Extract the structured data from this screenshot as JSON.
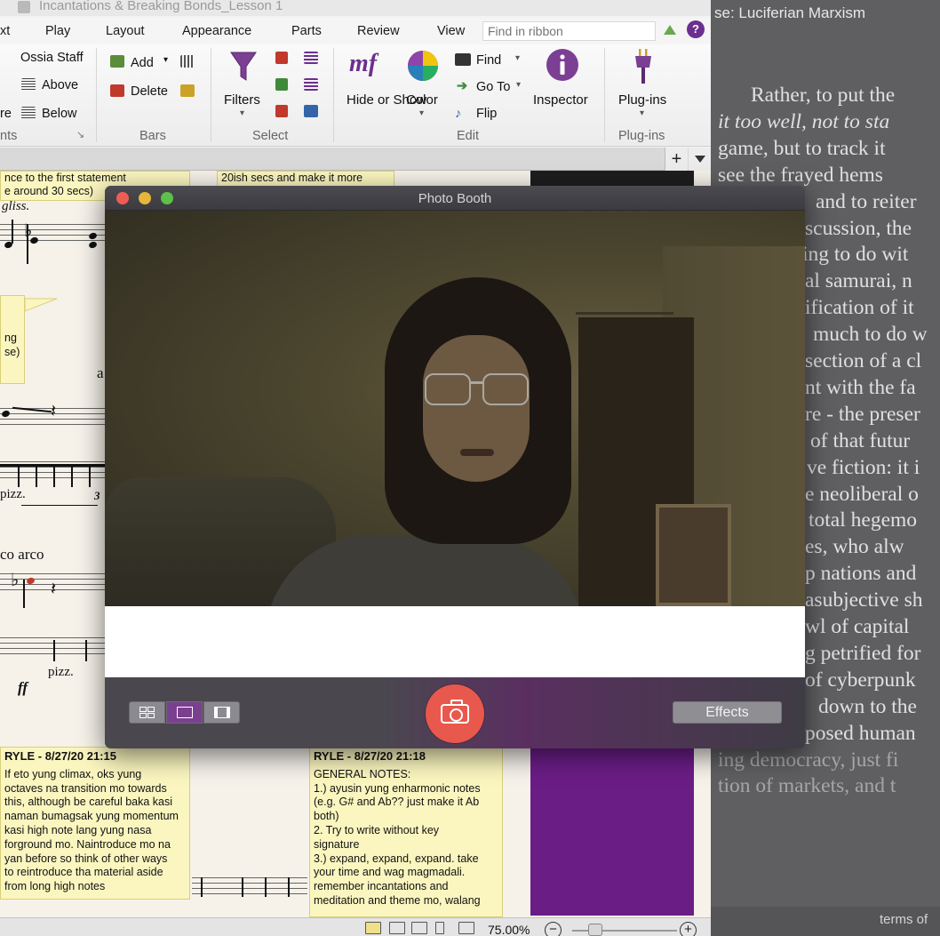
{
  "sibelius": {
    "window_title": "Incantations & Breaking Bonds_Lesson 1",
    "tabs": [
      "xt",
      "Play",
      "Layout",
      "Appearance",
      "Parts",
      "Review",
      "View"
    ],
    "find_placeholder": "Find in ribbon",
    "help_label": "?",
    "ribbon": {
      "staves": {
        "ossia_staff": "Ossia Staff",
        "above": "Above",
        "below": "Below",
        "re_fragment": "re",
        "group_label": "nts"
      },
      "bars": {
        "add": "Add",
        "delete": "Delete",
        "group_label": "Bars"
      },
      "select": {
        "filters": "Filters",
        "group_label": "Select"
      },
      "edit": {
        "hide_or_show": "Hide or Show",
        "color": "Color",
        "find": "Find",
        "go_to": "Go To",
        "flip": "Flip",
        "inspector": "Inspector",
        "group_label": "Edit"
      },
      "plugins": {
        "plugins_button": "Plug-ins",
        "group_label": "Plug-ins"
      }
    },
    "plus_label": "+",
    "score_texts": {
      "top_comment_line1": "nce to the first statement",
      "top_comment_line2": "e around 30 secs)",
      "top_comment_right": "20ish secs and make it more",
      "gliss": "gliss.",
      "left_comment_fragment1": "ng",
      "left_comment_fragment2": "se)",
      "a_fragment": "a",
      "pizz1": "pizz.",
      "triplet": "3",
      "arco": "co arco",
      "pizz2": "pizz.",
      "ff": "ff"
    },
    "comments": [
      {
        "header": "RYLE - 8/27/20 21:15",
        "body": "If eto yung climax, oks yung\noctaves na transition mo towards\nthis, although be careful baka kasi\nnaman bumagsak yung momentum\nkasi high note lang yung nasa\nforground mo. Naintroduce mo na\nyan before so think of other ways\nto reintroduce tha material aside\nfrom long high notes"
      },
      {
        "header": "RYLE - 8/27/20 21:18",
        "body": "GENERAL NOTES:\n1.) ayusin yung enharmonic notes\n(e.g. G# and Ab?? just make it  Ab\nboth)\n2. Try to write without key\nsignature\n3.) expand, expand, expand. take\nyour time and wag magmadali.\nremember incantations and\nmeditation and theme mo, walang"
      }
    ],
    "zoom_level": "75.00%",
    "zoom_minus": "−",
    "zoom_plus": "+",
    "zoom_fraction": 0.22
  },
  "reader": {
    "title": "se: Luciferian Marxism",
    "lines": [
      "Rather, to put the",
      "it too well, not to sta",
      "game, but to track it",
      "see the frayed hems",
      "and to reiter",
      "scussion, the",
      "ing to do wit",
      "al samurai, n",
      "ification of it",
      "much to do w",
      "section of a cl",
      "nt with the fa",
      "re - the preser",
      "of that futur",
      "ve fiction: it i",
      "e neoliberal o",
      "total hegemo",
      "es, who alw",
      "p nations and",
      "asubjective sh",
      "wl of capital",
      "g petrified for",
      "of cyberpunk",
      "down to the",
      "posed human",
      "ing democracy, just fi",
      "tion of markets, and t"
    ],
    "footer": "terms of"
  },
  "photobooth": {
    "title": "Photo Booth",
    "effects_label": "Effects",
    "view_modes": [
      "four-up",
      "single",
      "filmstrip"
    ],
    "selected_view": "single"
  },
  "colors": {
    "photobooth_shutter": "#e9584c",
    "selected_view_mode": "#7a3f8f",
    "sibelius_purple": "#6b1d86",
    "comment_yellow": "#fbf6bf"
  }
}
